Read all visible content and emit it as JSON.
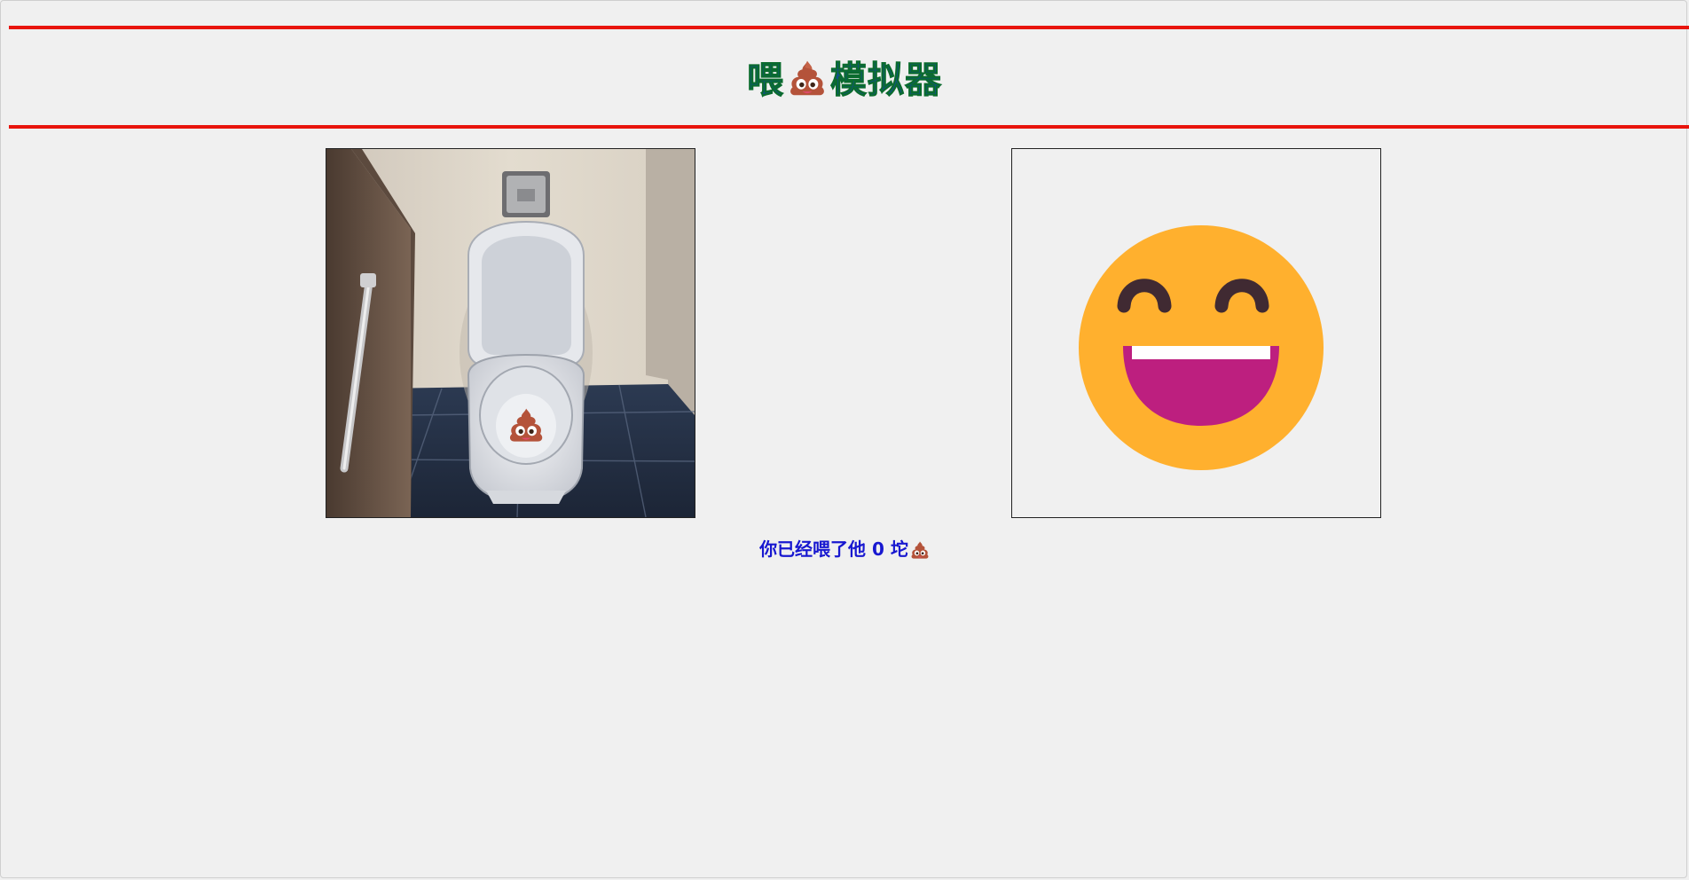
{
  "header": {
    "title_left": "喂",
    "title_right": "模拟器",
    "title_icon": "poop-icon"
  },
  "colors": {
    "rule": "#e8140c",
    "title_fill": "#0e4e8f",
    "title_stroke": "#0b6b2e",
    "counter_text": "#1818d0",
    "face": "#ffb02e",
    "mouth": "#bd1f7f",
    "poop": "#b4533a"
  },
  "toilet_panel": {
    "icon": "toilet-image",
    "target_icon": "poop-icon"
  },
  "face_panel": {
    "icon": "grinning-face-icon"
  },
  "counter": {
    "prefix": "你已经喂了他",
    "count": "0",
    "suffix": "坨",
    "icon": "poop-icon"
  }
}
